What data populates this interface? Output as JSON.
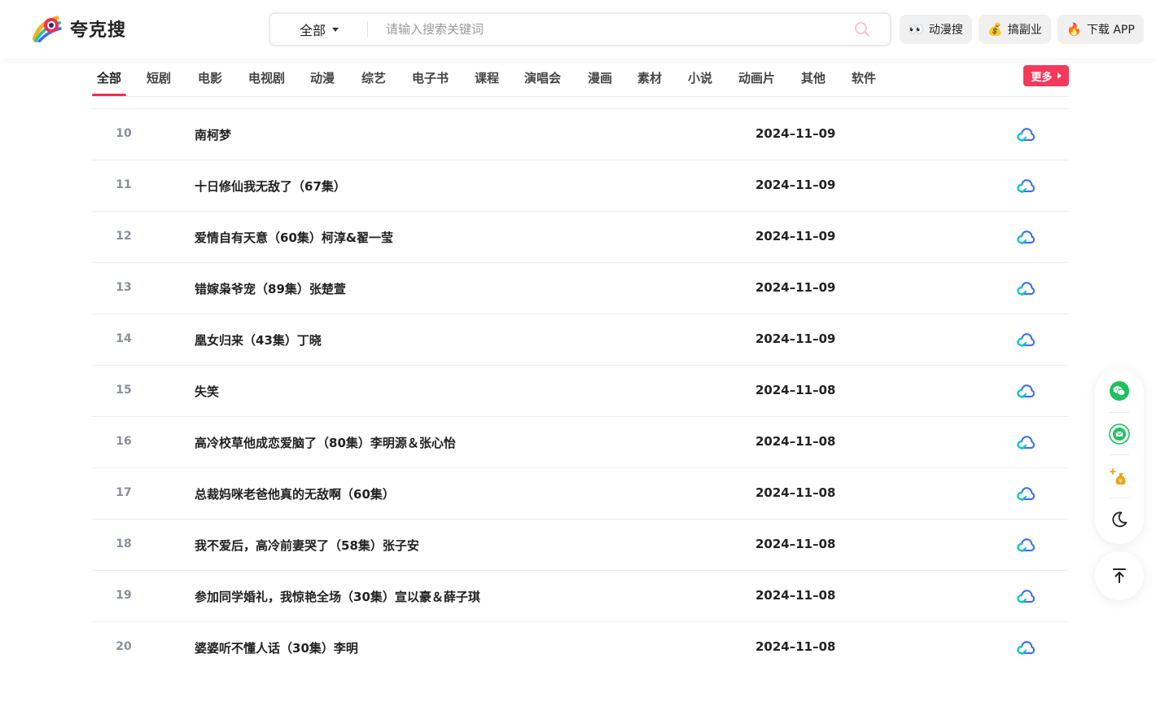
{
  "header": {
    "logo_text": "夸克搜",
    "search": {
      "scope": "全部",
      "placeholder": "请输入搜索关键词",
      "value": ""
    },
    "buttons": [
      {
        "icon": "👀",
        "label": "动漫搜"
      },
      {
        "icon": "💰",
        "label": "搞副业"
      },
      {
        "icon": "🔥",
        "label": "下载 APP"
      }
    ]
  },
  "categories": [
    "全部",
    "短剧",
    "电影",
    "电视剧",
    "动漫",
    "综艺",
    "电子书",
    "课程",
    "演唱会",
    "漫画",
    "素材",
    "小说",
    "动画片",
    "其他",
    "软件"
  ],
  "active_category": "全部",
  "more_label": "更多",
  "rows": [
    {
      "num": "10",
      "title": "南柯梦",
      "date": "2024–11–09"
    },
    {
      "num": "11",
      "title": "十日修仙我无敌了（67集）",
      "date": "2024–11–09"
    },
    {
      "num": "12",
      "title": "爱情自有天意（60集）柯淳&翟一莹",
      "date": "2024–11–09"
    },
    {
      "num": "13",
      "title": "错嫁枭爷宠（89集）张楚萱",
      "date": "2024–11–09"
    },
    {
      "num": "14",
      "title": "凰女归来（43集）丁晓",
      "date": "2024–11–09"
    },
    {
      "num": "15",
      "title": "失笑",
      "date": "2024–11–08"
    },
    {
      "num": "16",
      "title": "高冷校草他成恋爱脑了（80集）李明源＆张心怡",
      "date": "2024–11–08"
    },
    {
      "num": "17",
      "title": "总裁妈咪老爸他真的无敌啊（60集）",
      "date": "2024–11–08"
    },
    {
      "num": "18",
      "title": "我不爱后，高冷前妻哭了（58集）张子安",
      "date": "2024–11–08"
    },
    {
      "num": "19",
      "title": "参加同学婚礼，我惊艳全场（30集）宣以豪＆薛子琪",
      "date": "2024–11–08"
    },
    {
      "num": "20",
      "title": "婆婆听不懂人话（30集）李明",
      "date": "2024–11–08"
    }
  ],
  "colors": {
    "accent": "#f5395a",
    "cloud_blue": "#3b6cf6",
    "cloud_cyan": "#19c3c8",
    "wechat_green": "#1fc160"
  }
}
